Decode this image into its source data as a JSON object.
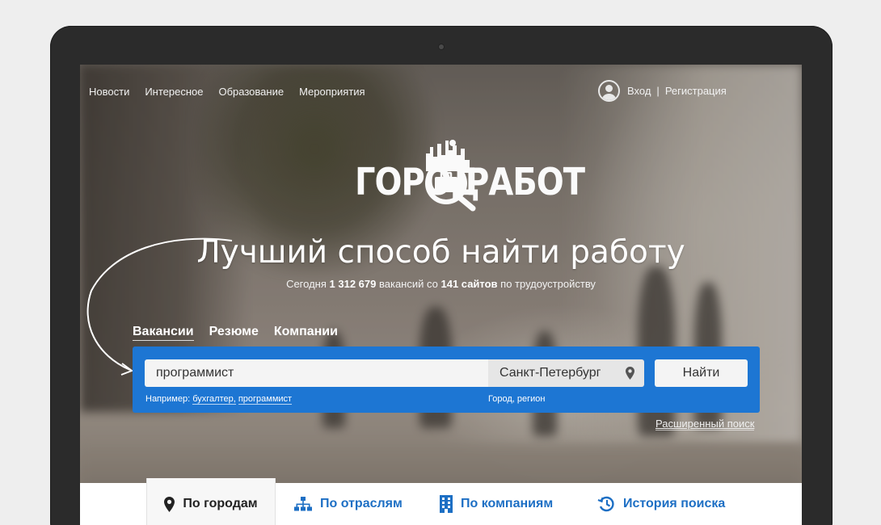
{
  "top_nav": {
    "items": [
      "Новости",
      "Интересное",
      "Образование",
      "Мероприятия"
    ]
  },
  "auth": {
    "login": "Вход",
    "separator": "|",
    "register": "Регистрация"
  },
  "logo": {
    "word_left": "ГОРОД",
    "word_right": "РАБОТ"
  },
  "hero": {
    "headline": "Лучший способ найти работу",
    "sub_prefix": "Сегодня",
    "vacancy_count": "1 312 679",
    "sub_middle": "вакансий со",
    "site_count": "141 сайтов",
    "sub_suffix": "по трудоустройству"
  },
  "search_tabs": [
    "Вакансии",
    "Резюме",
    "Компании"
  ],
  "search": {
    "query_value": "программист",
    "city_value": "Санкт-Петербург",
    "button_label": "Найти",
    "hint_prefix": "Например:",
    "hint_example_1": "бухгалтер,",
    "hint_example_2": "программист",
    "city_hint": "Город, регион",
    "advanced_link": "Расширенный поиск"
  },
  "bottom_tabs": [
    {
      "label": "По городам",
      "icon": "map-pin-icon"
    },
    {
      "label": "По отраслям",
      "icon": "hierarchy-icon"
    },
    {
      "label": "По компаниям",
      "icon": "building-icon"
    },
    {
      "label": "История поиска",
      "icon": "history-icon"
    }
  ],
  "colors": {
    "accent_blue": "#1d76d3",
    "link_blue": "#1d6fc4",
    "bezel": "#2b2b2b"
  }
}
